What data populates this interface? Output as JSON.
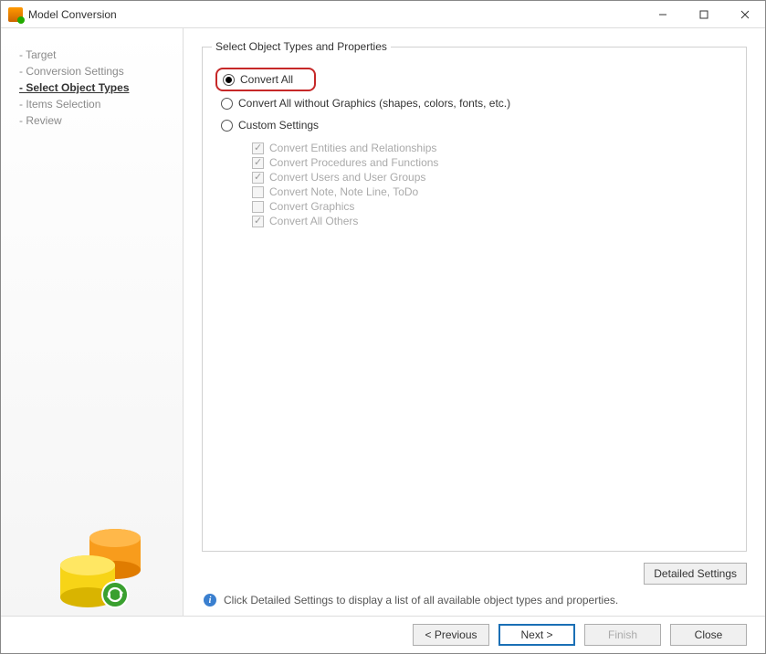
{
  "window": {
    "title": "Model Conversion"
  },
  "sidebar": {
    "steps": [
      {
        "label": "- Target",
        "active": false
      },
      {
        "label": "- Conversion Settings",
        "active": false
      },
      {
        "label": "- Select Object Types",
        "active": true
      },
      {
        "label": "- Items Selection",
        "active": false
      },
      {
        "label": "- Review",
        "active": false
      }
    ]
  },
  "panel": {
    "group_title": "Select Object Types and Properties",
    "radios": {
      "convert_all": "Convert All",
      "without_graphics": "Convert All without Graphics (shapes, colors, fonts, etc.)",
      "custom": "Custom Settings"
    },
    "subchecks": [
      {
        "label": "Convert Entities and Relationships",
        "checked": true
      },
      {
        "label": "Convert Procedures and Functions",
        "checked": true
      },
      {
        "label": "Convert Users and User Groups",
        "checked": true
      },
      {
        "label": "Convert Note, Note Line, ToDo",
        "checked": false
      },
      {
        "label": "Convert Graphics",
        "checked": false
      },
      {
        "label": "Convert All Others",
        "checked": true
      }
    ],
    "detailed_button": "Detailed Settings",
    "hint": "Click Detailed Settings to display a list of all available object types and properties."
  },
  "footer": {
    "previous": "< Previous",
    "next": "Next >",
    "finish": "Finish",
    "close": "Close"
  }
}
